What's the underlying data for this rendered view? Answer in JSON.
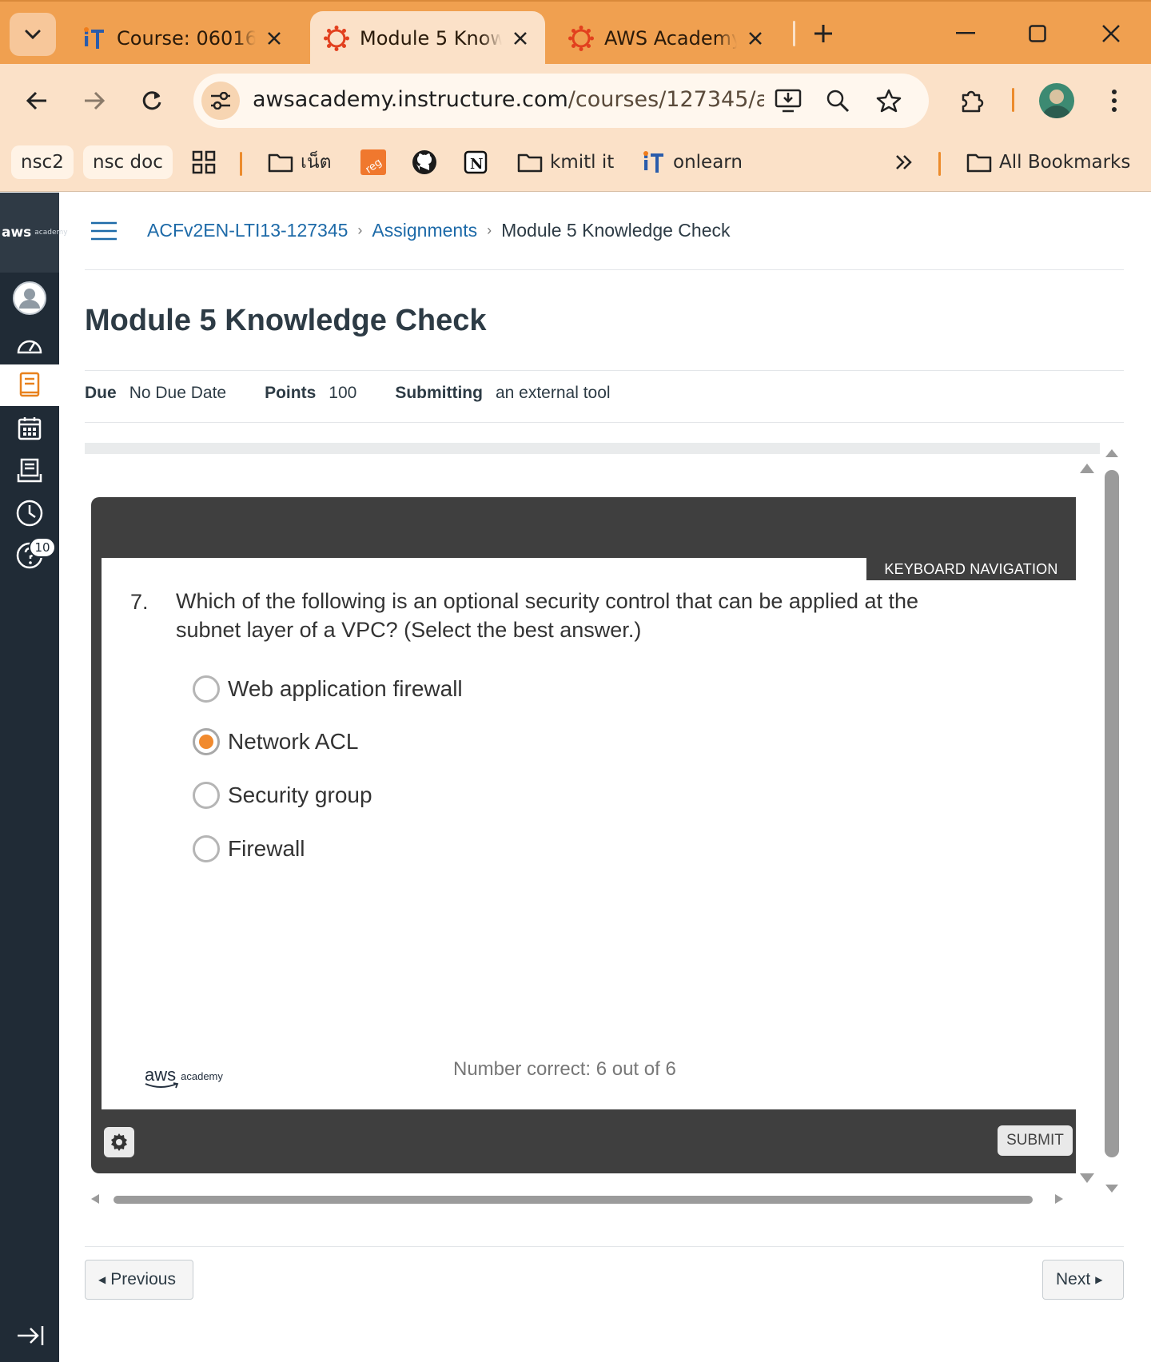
{
  "browser": {
    "tabs": [
      {
        "title": "Course: 060164",
        "icon": "it-logo-icon",
        "active": false
      },
      {
        "title": "Module 5 Know",
        "icon": "canvas-logo-icon",
        "active": true
      },
      {
        "title": "AWS Academy",
        "icon": "canvas-logo-icon",
        "active": false
      }
    ],
    "url_host": "awsacademy.instructure.com",
    "url_path": "/courses/127345/as...",
    "bookmarks": [
      {
        "label": "nsc2",
        "type": "pill"
      },
      {
        "label": "nsc doc",
        "type": "pill"
      },
      {
        "label": "",
        "type": "apps-icon"
      },
      {
        "label": "เน็ต",
        "type": "folder"
      },
      {
        "label": "",
        "type": "reg-icon"
      },
      {
        "label": "",
        "type": "github-icon"
      },
      {
        "label": "",
        "type": "notion-icon"
      },
      {
        "label": "kmitl it",
        "type": "folder"
      },
      {
        "label": "onlearn",
        "type": "it-logo"
      }
    ],
    "all_bookmarks": "All Bookmarks"
  },
  "colors": {
    "tabstrip": "#f0a050",
    "toolbar": "#fbe1c8",
    "canvas_nav": "#202b36",
    "link": "#1d6aa8",
    "radio_selected": "#f18a2e"
  },
  "leftnav": {
    "logo_aws": "aws",
    "logo_academy": "academy",
    "items": [
      "account-icon",
      "dashboard-icon",
      "courses-icon",
      "calendar-icon",
      "inbox-icon",
      "history-icon",
      "help-icon"
    ],
    "help_badge": "10"
  },
  "breadcrumb": {
    "course": "ACFv2EN-LTI13-127345",
    "section": "Assignments",
    "current": "Module 5 Knowledge Check"
  },
  "assignment": {
    "title": "Module 5 Knowledge Check",
    "due_label": "Due",
    "due_value": "No Due Date",
    "points_label": "Points",
    "points_value": "100",
    "submitting_label": "Submitting",
    "submitting_value": "an external tool"
  },
  "quiz": {
    "keyboard_nav": "KEYBOARD NAVIGATION",
    "question_number": "7.",
    "question_text": "Which of the following is an optional security control that can be applied at the subnet layer of a VPC? (Select the best answer.)",
    "options": [
      {
        "label": "Web application firewall",
        "selected": false
      },
      {
        "label": "Network ACL",
        "selected": true
      },
      {
        "label": "Security group",
        "selected": false
      },
      {
        "label": "Firewall",
        "selected": false
      }
    ],
    "brand_aws": "aws",
    "brand_academy": "academy",
    "number_correct": "Number correct: 6 out of 6",
    "submit_label": "SUBMIT"
  },
  "footer": {
    "previous_label": "Previous",
    "next_label": "Next"
  }
}
